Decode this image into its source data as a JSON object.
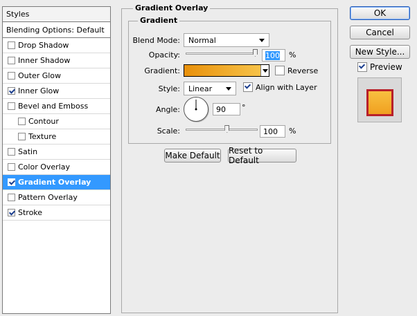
{
  "styles_panel": {
    "header": "Styles",
    "blending_options": "Blending Options: Default",
    "items": [
      {
        "label": "Drop Shadow",
        "checked": false
      },
      {
        "label": "Inner Shadow",
        "checked": false
      },
      {
        "label": "Outer Glow",
        "checked": false
      },
      {
        "label": "Inner Glow",
        "checked": true
      },
      {
        "label": "Bevel and Emboss",
        "checked": false
      },
      {
        "label": "Contour",
        "checked": false
      },
      {
        "label": "Texture",
        "checked": false
      },
      {
        "label": "Satin",
        "checked": false
      },
      {
        "label": "Color Overlay",
        "checked": false
      },
      {
        "label": "Gradient Overlay",
        "checked": true
      },
      {
        "label": "Pattern Overlay",
        "checked": false
      },
      {
        "label": "Stroke",
        "checked": true
      }
    ]
  },
  "panel": {
    "title": "Gradient Overlay",
    "group_title": "Gradient",
    "blend_mode_label": "Blend Mode:",
    "blend_mode_value": "Normal",
    "opacity_label": "Opacity:",
    "opacity_value": "100",
    "opacity_unit": "%",
    "opacity_level_percent": 100,
    "gradient_label": "Gradient:",
    "reverse_label": "Reverse",
    "reverse_checked": false,
    "style_label": "Style:",
    "style_value": "Linear",
    "align_label": "Align with Layer",
    "align_checked": true,
    "angle_label": "Angle:",
    "angle_value": "90",
    "angle_unit": "°",
    "scale_label": "Scale:",
    "scale_value": "100",
    "scale_unit": "%",
    "scale_level_percent": 100,
    "make_default": "Make Default",
    "reset_default": "Reset to Default"
  },
  "buttons": {
    "ok": "OK",
    "cancel": "Cancel",
    "new_style": "New Style..."
  },
  "preview": {
    "label": "Preview",
    "checked": true
  },
  "colors": {
    "selection": "#3399ff",
    "gradient_start": "#e8900a",
    "gradient_end": "#f8c850",
    "preview_stroke": "#b8202a"
  }
}
